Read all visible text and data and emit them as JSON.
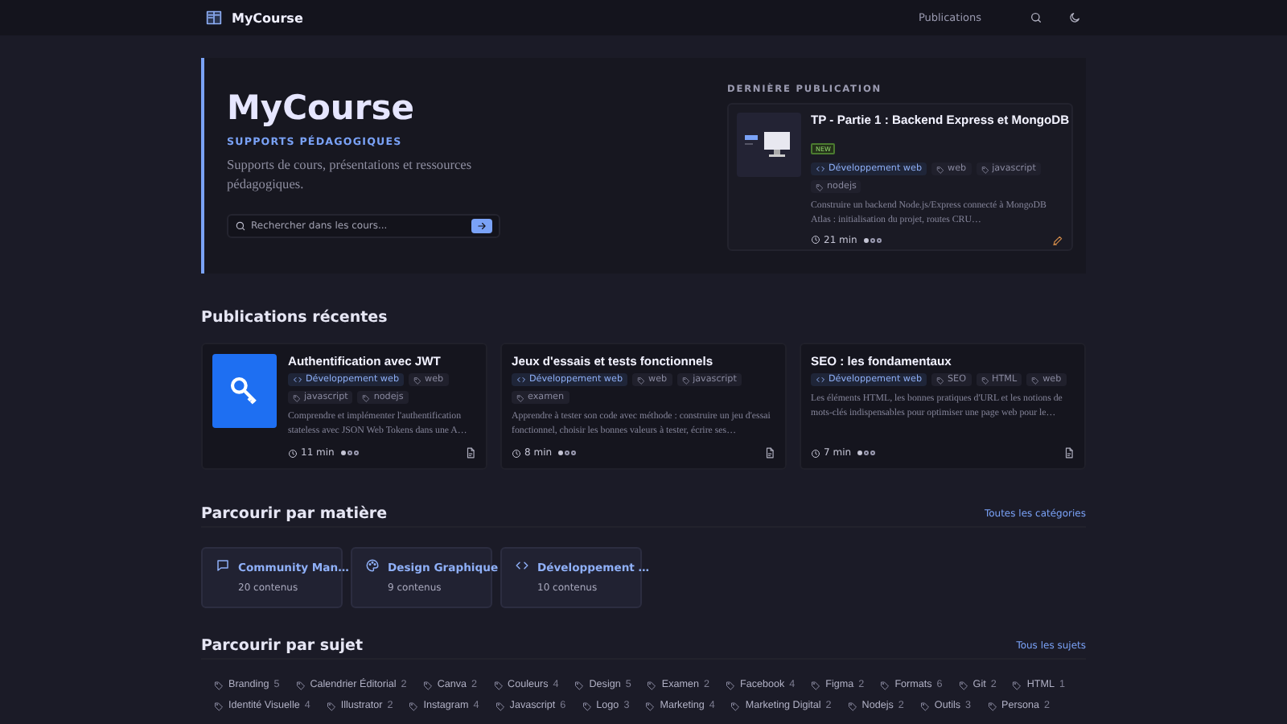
{
  "header": {
    "logo": "MyCourse",
    "nav": [
      {
        "label": "Publications"
      }
    ]
  },
  "hero": {
    "title": "MyCourse",
    "subtitle": "SUPPORTS PÉDAGOGIQUES",
    "description": "Supports de cours, présentations et ressources pédagogiques.",
    "search": {
      "placeholder": "Rechercher dans les cours..."
    }
  },
  "latest": {
    "heading": "DERNIÈRE PUBLICATION",
    "post": {
      "title": "TP - Partie 1 : Backend Express et MongoDB",
      "thumbnail": true,
      "badge": "NEW",
      "tags": [
        {
          "kind": "category",
          "label": "Développement web"
        },
        {
          "kind": "tag",
          "label": "web"
        },
        {
          "kind": "tag",
          "label": "javascript"
        },
        {
          "kind": "tag",
          "label": "nodejs"
        }
      ],
      "description": "Construire un backend Node.js/Express connecté à MongoDB Atlas : initialisation du projet, routes CRU…",
      "duration": "21 min",
      "stars": 1
    }
  },
  "recent": {
    "heading": "Publications récentes",
    "posts": [
      {
        "title": "Authentification avec JWT",
        "thumbnail": true,
        "tags": [
          {
            "kind": "category",
            "label": "Développement web"
          },
          {
            "kind": "tag",
            "label": "web"
          },
          {
            "kind": "tag",
            "label": "javascript"
          },
          {
            "kind": "tag",
            "label": "nodejs"
          }
        ],
        "description": "Comprendre et implémenter l'authentification stateless avec JSON Web Tokens dans une A…",
        "duration": "11 min",
        "stars": 1
      },
      {
        "title": "Jeux d'essais et tests fonctionnels",
        "tags": [
          {
            "kind": "category",
            "label": "Développement web"
          },
          {
            "kind": "tag",
            "label": "web"
          },
          {
            "kind": "tag",
            "label": "javascript"
          },
          {
            "kind": "tag",
            "label": "examen"
          }
        ],
        "description": "Apprendre à tester son code avec méthode : construire un jeu d'essai fonctionnel, choisir les bonnes valeurs à tester, écrire ses…",
        "duration": "8 min",
        "stars": 1
      },
      {
        "title": "SEO : les fondamentaux",
        "tags": [
          {
            "kind": "category",
            "label": "Développement web"
          },
          {
            "kind": "tag",
            "label": "SEO"
          },
          {
            "kind": "tag",
            "label": "HTML"
          },
          {
            "kind": "tag",
            "label": "web"
          }
        ],
        "description": "Les éléments HTML, les bonnes pratiques d'URL et les notions de mots-clés indispensables pour optimiser une page web pour le…",
        "duration": "7 min",
        "stars": 1
      }
    ]
  },
  "subjects": {
    "heading": "Parcourir par matière",
    "link": "Toutes les catégories",
    "items": [
      {
        "kind": "chat",
        "name": "Community Man…",
        "count": "20 contenus"
      },
      {
        "kind": "palette",
        "name": "Design Graphique",
        "count": "9 contenus"
      },
      {
        "kind": "code",
        "name": "Développement …",
        "count": "10 contenus"
      }
    ]
  },
  "topics": {
    "heading": "Parcourir par sujet",
    "link": "Tous les sujets",
    "items": [
      {
        "name": "Branding",
        "count": "5"
      },
      {
        "name": "Calendrier Éditorial",
        "count": "2"
      },
      {
        "name": "Canva",
        "count": "2"
      },
      {
        "name": "Couleurs",
        "count": "4"
      },
      {
        "name": "Design",
        "count": "5"
      },
      {
        "name": "Examen",
        "count": "2"
      },
      {
        "name": "Facebook",
        "count": "4"
      },
      {
        "name": "Figma",
        "count": "2"
      },
      {
        "name": "Formats",
        "count": "6"
      },
      {
        "name": "Git",
        "count": "2"
      },
      {
        "name": "HTML",
        "count": "1"
      },
      {
        "name": "Identité Visuelle",
        "count": "4"
      },
      {
        "name": "Illustrator",
        "count": "2"
      },
      {
        "name": "Instagram",
        "count": "4"
      },
      {
        "name": "Javascript",
        "count": "6"
      },
      {
        "name": "Logo",
        "count": "3"
      },
      {
        "name": "Marketing",
        "count": "4"
      },
      {
        "name": "Marketing Digital",
        "count": "2"
      },
      {
        "name": "Nodejs",
        "count": "2"
      },
      {
        "name": "Outils",
        "count": "3"
      },
      {
        "name": "Persona",
        "count": "2"
      }
    ]
  }
}
